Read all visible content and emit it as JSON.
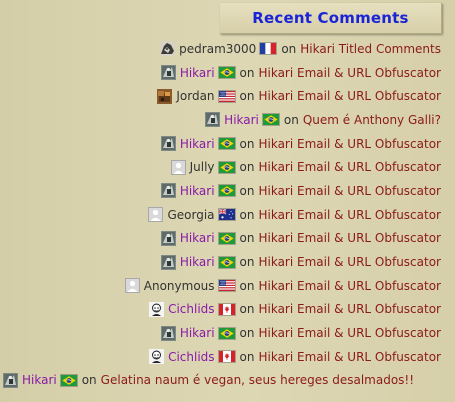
{
  "widget": {
    "title": "Recent Comments"
  },
  "comments": [
    {
      "author": "pedram3000",
      "linked": false,
      "avatar": "pedram-avatar-icon",
      "flag": "fr",
      "on": "on",
      "post": "Hikari Titled Comments"
    },
    {
      "author": "Hikari",
      "linked": true,
      "avatar": "hikari-avatar-icon",
      "flag": "br",
      "on": "on",
      "post": "Hikari Email & URL Obfuscator"
    },
    {
      "author": "Jordan",
      "linked": false,
      "avatar": "jordan-avatar-icon",
      "flag": "us",
      "on": "on",
      "post": "Hikari Email & URL Obfuscator"
    },
    {
      "author": "Hikari",
      "linked": true,
      "avatar": "hikari-avatar-icon",
      "flag": "br",
      "on": "on",
      "post": "Quem é Anthony Galli?"
    },
    {
      "author": "Hikari",
      "linked": true,
      "avatar": "hikari-avatar-icon",
      "flag": "br",
      "on": "on",
      "post": "Hikari Email & URL Obfuscator"
    },
    {
      "author": "Jully",
      "linked": false,
      "avatar": "default-avatar-icon",
      "flag": "br",
      "on": "on",
      "post": "Hikari Email & URL Obfuscator"
    },
    {
      "author": "Hikari",
      "linked": true,
      "avatar": "hikari-avatar-icon",
      "flag": "br",
      "on": "on",
      "post": "Hikari Email & URL Obfuscator"
    },
    {
      "author": "Georgia",
      "linked": false,
      "avatar": "default-avatar-icon",
      "flag": "au",
      "on": "on",
      "post": "Hikari Email & URL Obfuscator"
    },
    {
      "author": "Hikari",
      "linked": true,
      "avatar": "hikari-avatar-icon",
      "flag": "br",
      "on": "on",
      "post": "Hikari Email & URL Obfuscator"
    },
    {
      "author": "Hikari",
      "linked": true,
      "avatar": "hikari-avatar-icon",
      "flag": "br",
      "on": "on",
      "post": "Hikari Email & URL Obfuscator"
    },
    {
      "author": "Anonymous",
      "linked": false,
      "avatar": "default-avatar-icon",
      "flag": "us",
      "on": "on",
      "post": "Hikari Email & URL Obfuscator"
    },
    {
      "author": "Cichlids",
      "linked": true,
      "avatar": "cichlids-avatar-icon",
      "flag": "ca",
      "on": "on",
      "post": "Hikari Email & URL Obfuscator"
    },
    {
      "author": "Hikari",
      "linked": true,
      "avatar": "hikari-avatar-icon",
      "flag": "br",
      "on": "on",
      "post": "Hikari Email & URL Obfuscator"
    },
    {
      "author": "Cichlids",
      "linked": true,
      "avatar": "cichlids-avatar-icon",
      "flag": "ca",
      "on": "on",
      "post": "Hikari Email & URL Obfuscator"
    },
    {
      "author": "Hikari",
      "linked": true,
      "avatar": "hikari-avatar-icon",
      "flag": "br",
      "on": "on",
      "post": "Gelatina naum é vegan, seus hereges desalmados!!"
    }
  ],
  "colors": {
    "title": "#1a24d6",
    "author_link": "#8a1aa8",
    "post_link": "#8b1a1a",
    "background": "#d8d1ab"
  }
}
